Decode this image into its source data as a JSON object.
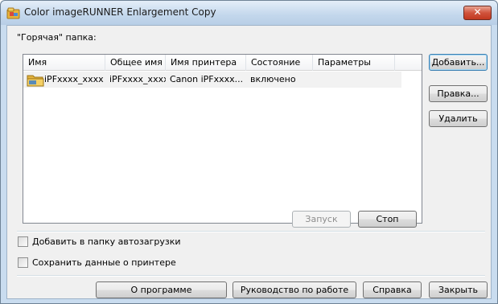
{
  "window": {
    "title": "Color imageRUNNER Enlargement Copy",
    "close_label": "✕"
  },
  "hot_folder_label": "\"Горячая\" папка:",
  "list": {
    "columns": [
      "Имя",
      "Общее имя",
      "Имя принтера",
      "Состояние",
      "Параметры"
    ],
    "rows": [
      {
        "name": "iPFxxxx_xxxx",
        "share_name": "iPFxxxx_xxxx",
        "printer_name": "Canon iPFxxxx...",
        "state": "включено",
        "params": ""
      }
    ]
  },
  "side_buttons": {
    "add": "Добавить...",
    "edit": "Правка...",
    "delete": "Удалить"
  },
  "run_buttons": {
    "start": "Запуск",
    "stop": "Стоп"
  },
  "options": {
    "autostart": "Добавить в папку автозагрузки",
    "save_printer": "Сохранить данные о принтере"
  },
  "footer": {
    "about": "О программе",
    "guide": "Руководство по работе",
    "help": "Справка",
    "close": "Закрыть"
  }
}
